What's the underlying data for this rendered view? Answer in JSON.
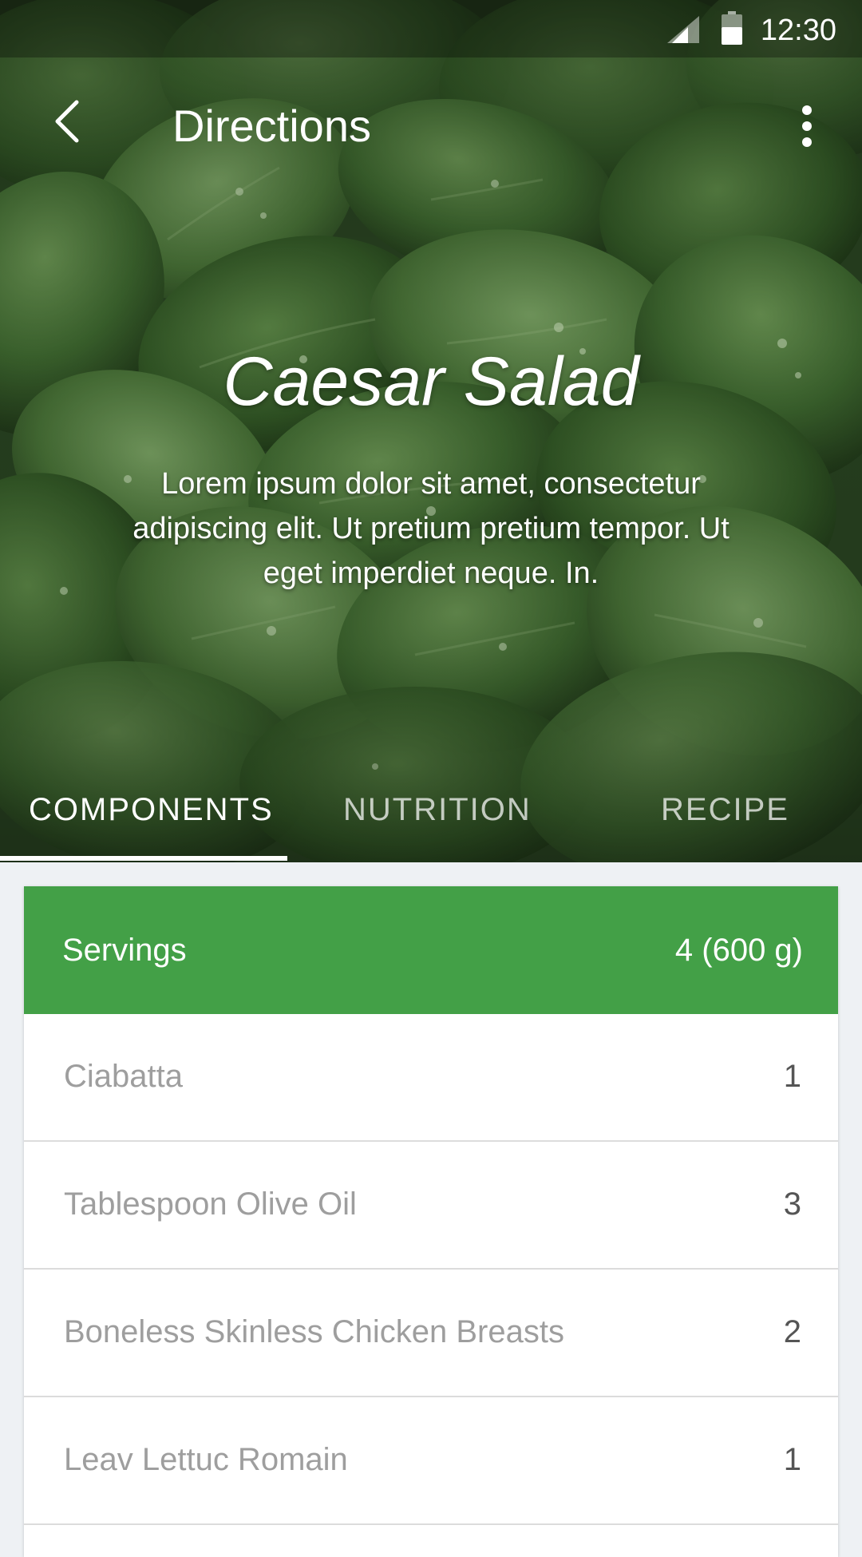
{
  "status_bar": {
    "time": "12:30",
    "icons": [
      "signal-icon",
      "battery-icon"
    ]
  },
  "toolbar": {
    "title": "Directions",
    "back_icon": "chevron-left-icon",
    "menu_icon": "more-vert-icon"
  },
  "hero": {
    "title": "Caesar Salad",
    "description": "Lorem ipsum dolor sit amet, consectetur adipiscing elit. Ut pretium pretium tempor. Ut eget imperdiet neque. In.",
    "background": "spinach-leaves-photo"
  },
  "tabs": [
    {
      "label": "COMPONENTS",
      "selected": true
    },
    {
      "label": "NUTRITION",
      "selected": false
    },
    {
      "label": "RECIPE",
      "selected": false
    }
  ],
  "servings": {
    "label": "Servings",
    "value": "4 (600 g)"
  },
  "ingredients": [
    {
      "name": "Ciabatta",
      "qty": "1"
    },
    {
      "name": "Tablespoon Olive Oil",
      "qty": "3"
    },
    {
      "name": "Boneless Skinless Chicken Breasts",
      "qty": "2"
    },
    {
      "name": "Leav Lettuc Romain",
      "qty": "1"
    }
  ],
  "colors": {
    "accent": "#43a047",
    "background": "#eef1f4",
    "muted_text": "#9e9e9e"
  }
}
